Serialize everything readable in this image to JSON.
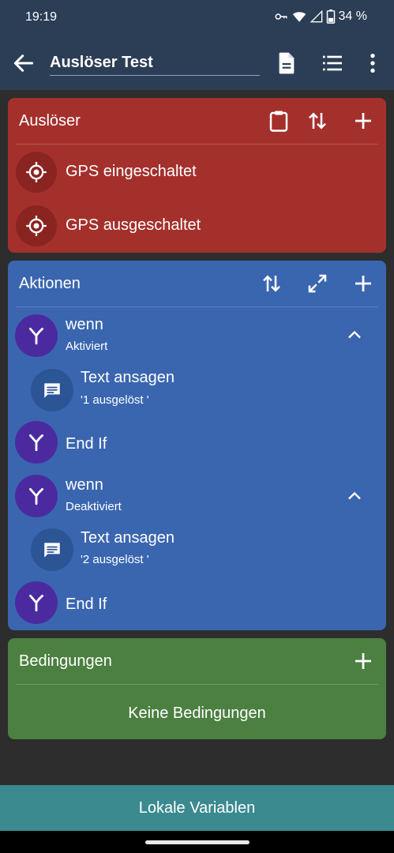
{
  "status": {
    "time": "19:19",
    "battery": "34 %"
  },
  "appbar": {
    "title": "Auslöser Test"
  },
  "triggers": {
    "header": "Auslöser",
    "items": [
      {
        "label": "GPS eingeschaltet"
      },
      {
        "label": "GPS ausgeschaltet"
      }
    ]
  },
  "actions": {
    "header": "Aktionen",
    "items": [
      {
        "title": "wenn",
        "subtitle": "Aktiviert"
      },
      {
        "title": "Text ansagen",
        "subtitle": "'1 ausgelöst '"
      },
      {
        "title": "End If"
      },
      {
        "title": "wenn",
        "subtitle": "Deaktiviert"
      },
      {
        "title": "Text ansagen",
        "subtitle": "'2 ausgelöst '"
      },
      {
        "title": "End If"
      }
    ]
  },
  "conditions": {
    "header": "Bedingungen",
    "empty": "Keine Bedingungen"
  },
  "bottom": {
    "label": "Lokale Variablen"
  },
  "colors": {
    "appbar": "#2c3e56",
    "triggers": "#a4302c",
    "actions": "#3a66b0",
    "conditions": "#4b8040",
    "bottom": "#3a8a90",
    "branch_icon_bg": "#4b2aa0"
  }
}
